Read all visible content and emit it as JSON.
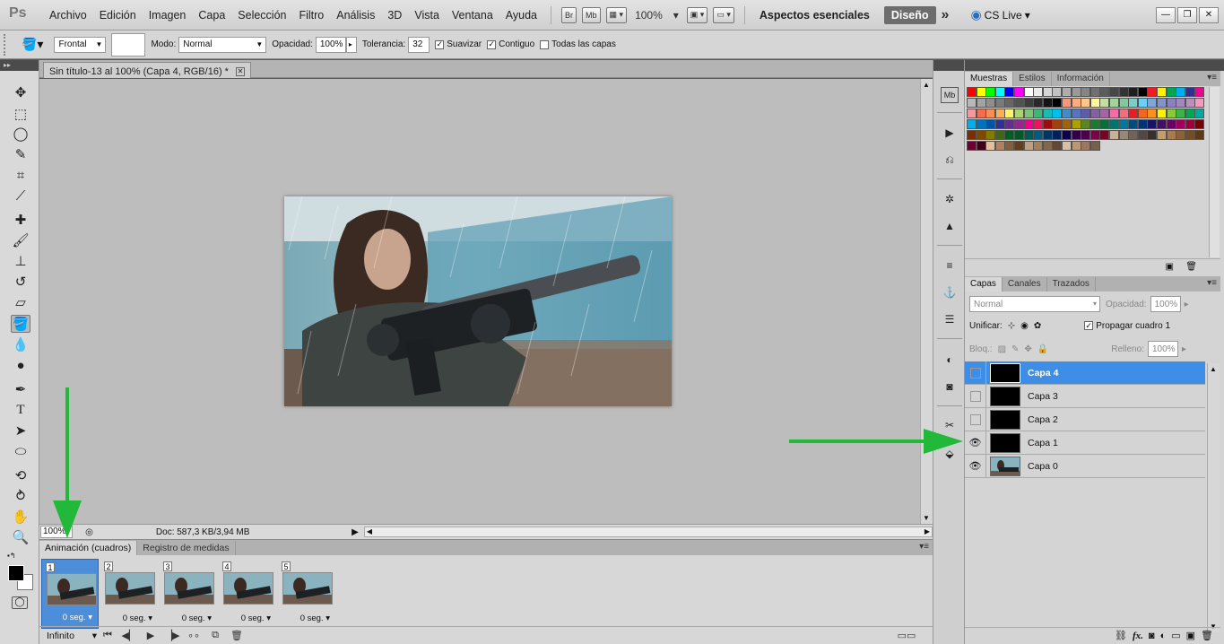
{
  "menubar": {
    "logo": "Ps",
    "items": [
      "Archivo",
      "Edición",
      "Imagen",
      "Capa",
      "Selección",
      "Filtro",
      "Análisis",
      "3D",
      "Vista",
      "Ventana",
      "Ayuda"
    ],
    "bridge_label": "Br",
    "minibridge_label": "Mb",
    "zoom": "100%",
    "workspace_essentials": "Aspectos esenciales",
    "workspace_design": "Diseño",
    "more": "»",
    "cs_live": "CS Live"
  },
  "options": {
    "source_label": "Frontal",
    "mode_label": "Modo:",
    "mode_value": "Normal",
    "opacity_label": "Opacidad:",
    "opacity_value": "100%",
    "tolerance_label": "Tolerancia:",
    "tolerance_value": "32",
    "smooth_label": "Suavizar",
    "contiguous_label": "Contiguo",
    "all_layers_label": "Todas las capas"
  },
  "document": {
    "tab_title": "Sin título-13 al 100% (Capa 4, RGB/16) *",
    "zoom": "100%",
    "info": "Doc: 587,3 KB/3,94 MB"
  },
  "animation": {
    "tabs": [
      "Animación (cuadros)",
      "Registro de medidas"
    ],
    "frames": [
      {
        "num": "1",
        "delay": "0 seg."
      },
      {
        "num": "2",
        "delay": "0 seg."
      },
      {
        "num": "3",
        "delay": "0 seg."
      },
      {
        "num": "4",
        "delay": "0 seg."
      },
      {
        "num": "5",
        "delay": "0 seg."
      }
    ],
    "loop": "Infinito"
  },
  "swatches_panel": {
    "tabs": [
      "Muestras",
      "Estilos",
      "Información"
    ]
  },
  "layers_panel": {
    "tabs": [
      "Capas",
      "Canales",
      "Trazados"
    ],
    "blend_mode": "Normal",
    "opacity_label": "Opacidad:",
    "opacity_value": "100%",
    "unify_label": "Unificar:",
    "propagate_label": "Propagar cuadro 1",
    "lock_label": "Bloq.:",
    "fill_label": "Relleno:",
    "fill_value": "100%",
    "layers": [
      {
        "name": "Capa 4",
        "visible": false,
        "selected": true
      },
      {
        "name": "Capa 3",
        "visible": false,
        "selected": false
      },
      {
        "name": "Capa 2",
        "visible": false,
        "selected": false
      },
      {
        "name": "Capa 1",
        "visible": true,
        "selected": false
      },
      {
        "name": "Capa 0",
        "visible": true,
        "selected": false
      }
    ],
    "footer_fx": "fx."
  },
  "colors": {
    "accent_blue": "#3e8ee8",
    "annotation_arrow": "#22b83a",
    "ui_gray": "#d6d6d6"
  }
}
